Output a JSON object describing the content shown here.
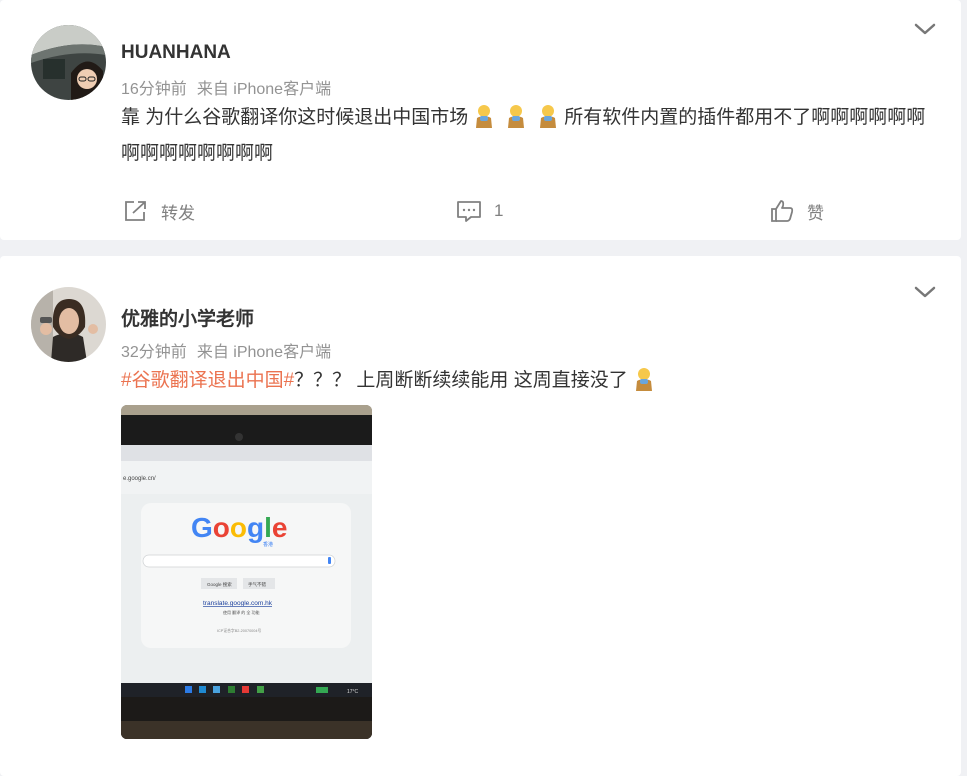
{
  "posts": [
    {
      "username": "HUANHANA",
      "time": "16分钟前",
      "source": "来自 iPhone客户端",
      "text_part1": "靠 为什么谷歌翻译你这时候退出中国市场",
      "text_part2": "所有软件内置的插件都用不了啊啊啊啊啊啊啊啊啊啊啊啊啊啊",
      "forward_label": "转发",
      "comment_count": "1",
      "like_label": "赞"
    },
    {
      "username": "优雅的小学老师",
      "time": "32分钟前",
      "source": "来自 iPhone客户端",
      "hashtag": "#谷歌翻译退出中国#",
      "text": "？？？ 上周断断续续能用 这周直接没了",
      "photo": {
        "url_text": "e.google.cn/",
        "google_logo": "Google",
        "logo_sub": "香港",
        "button1": "Google 搜索",
        "button2": "手气不错",
        "link": "translate.google.com.hk",
        "link_sub": "使用 翻译 的 全 功能",
        "icp": "ICP证合字B2-20070004号",
        "temp": "17°C"
      }
    }
  ],
  "colors": {
    "hashtag": "#eb7350",
    "meta": "#939393",
    "action": "#808080"
  },
  "icons": [
    "chevron-down-icon",
    "forward-icon",
    "comment-icon",
    "like-icon",
    "facepalm-emoji"
  ]
}
